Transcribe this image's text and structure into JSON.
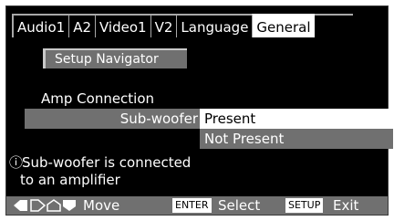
{
  "tabs": [
    "Audio1",
    "A2",
    "Video1",
    "V2",
    "Language",
    "General"
  ],
  "active_tab": "General",
  "setup_navigator_label": "Setup Navigator",
  "section_label": "Amp Connection",
  "field": {
    "label": "Sub-woofer",
    "options": [
      "Present",
      "Not Present"
    ],
    "selected": "Present"
  },
  "info": {
    "icon": "ⓘ",
    "line1": "Sub-woofer is connected",
    "line2": "to an amplifier"
  },
  "footer": {
    "move_label": "Move",
    "enter_key": "ENTER",
    "select_label": "Select",
    "setup_key": "SETUP",
    "exit_label": "Exit"
  },
  "colors": {
    "screen_bg": "#000000",
    "highlight": "#ffffff",
    "bar_gray": "#707070",
    "tab_border": "#a8a8a8"
  }
}
